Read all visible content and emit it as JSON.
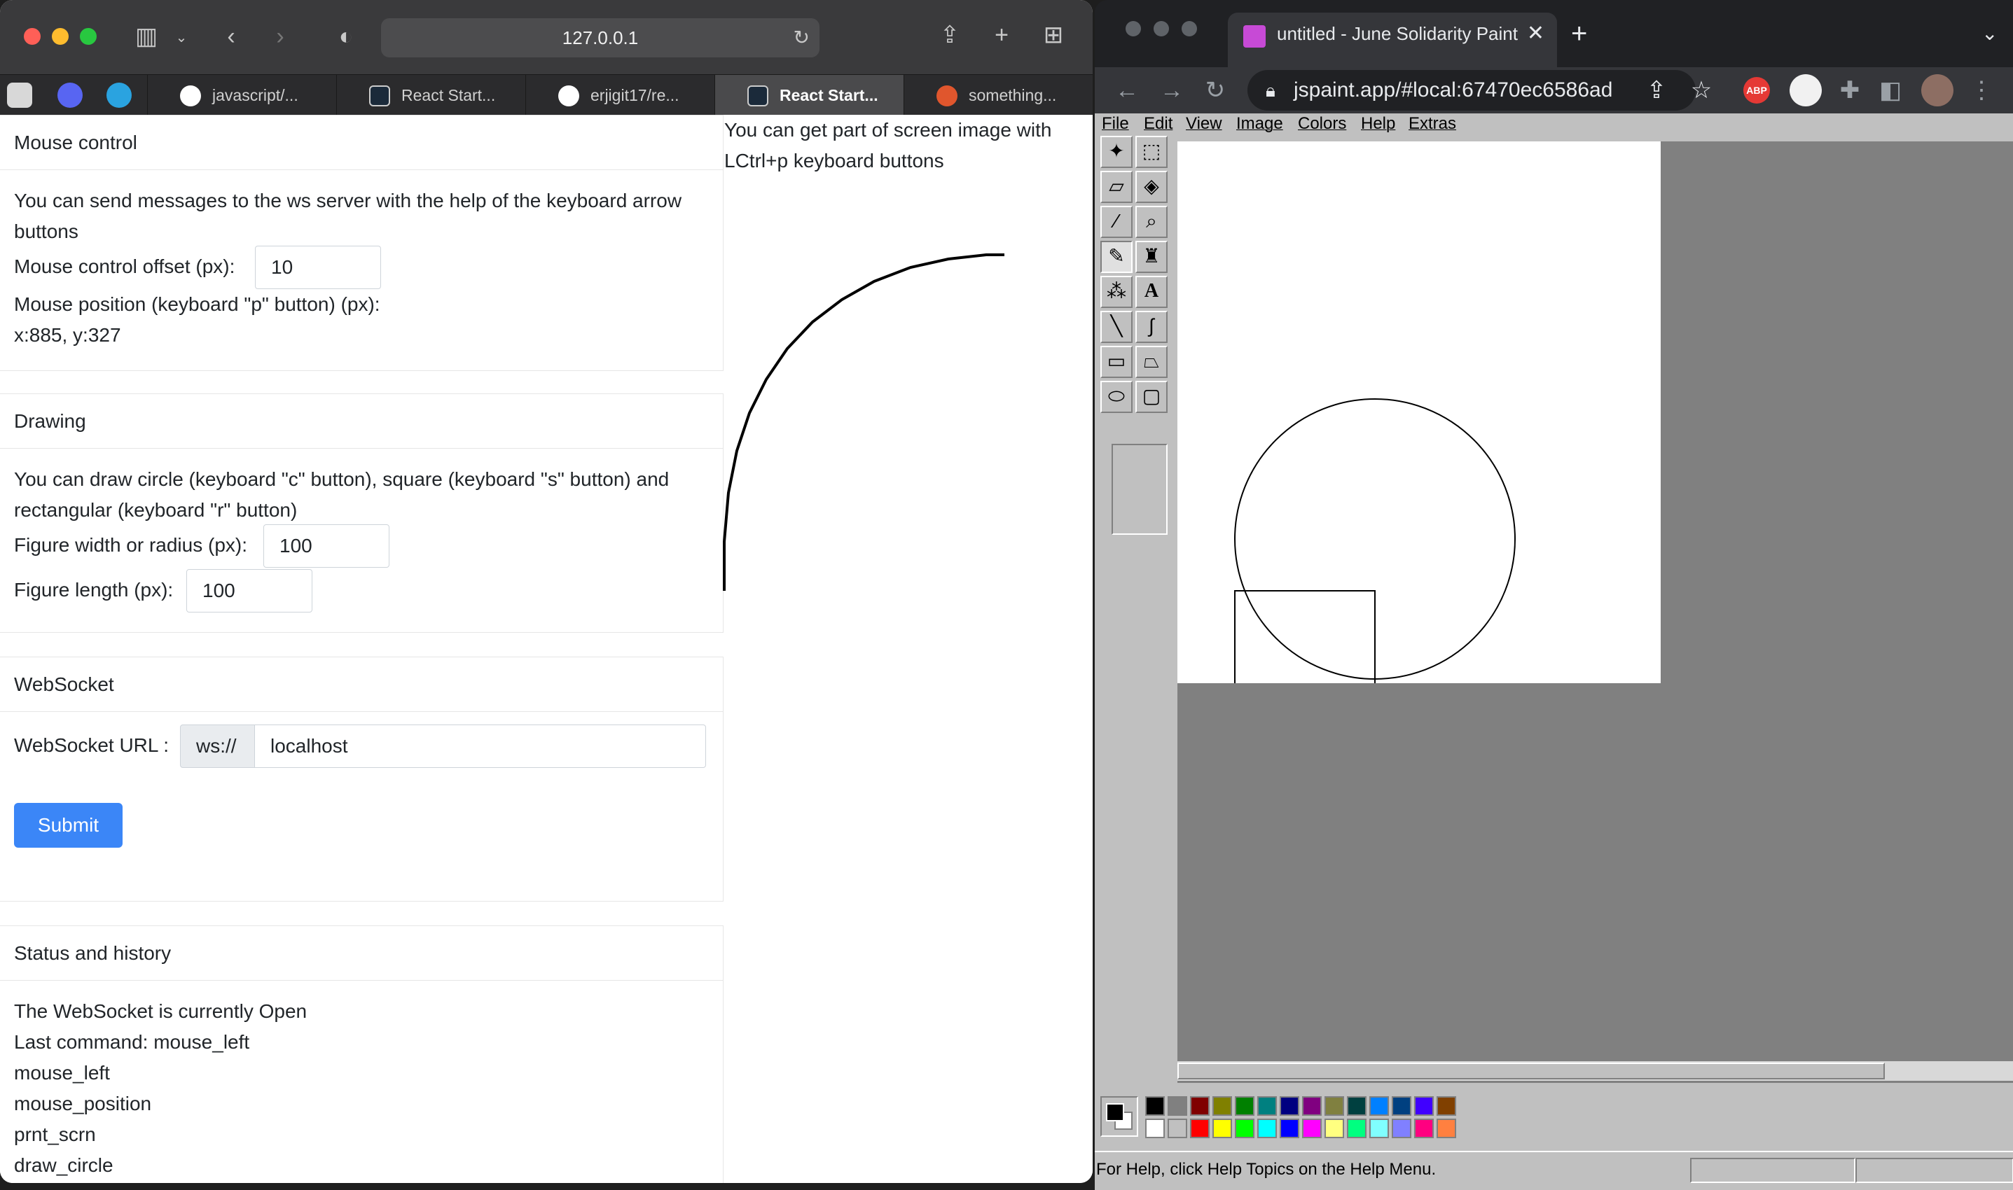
{
  "safari": {
    "url": "127.0.0.1",
    "tabs": [
      {
        "label": "javascript/...",
        "icon": "github-icon",
        "active": false
      },
      {
        "label": "React Start...",
        "icon": "react-starter-icon",
        "active": false
      },
      {
        "label": "erjigit17/re...",
        "icon": "github-icon",
        "active": false
      },
      {
        "label": "React Start...",
        "icon": "react-starter-icon",
        "active": true
      },
      {
        "label": "something...",
        "icon": "rs-school-icon",
        "active": false
      }
    ],
    "pinned_icons": [
      "rs-icon",
      "discord-icon",
      "telegram-icon"
    ]
  },
  "app": {
    "mouse_control": {
      "title": "Mouse control",
      "description": "You can send messages to the ws server with the help of the keyboard arrow buttons",
      "offset_label": "Mouse control offset (px):",
      "offset_value": "10",
      "position_label": "Mouse position (keyboard \"p\" button) (px):",
      "position_value": "x:885, y:327"
    },
    "drawing": {
      "title": "Drawing",
      "description": "You can draw circle (keyboard \"c\" button), square (keyboard \"s\" button) and rectangular (keyboard \"r\" button)",
      "width_label": "Figure width or radius (px):",
      "width_value": "100",
      "length_label": "Figure length (px):",
      "length_value": "100"
    },
    "websocket": {
      "title": "WebSocket",
      "url_label": "WebSocket URL :",
      "prefix": "ws://",
      "url_value": "localhost",
      "submit_label": "Submit"
    },
    "status": {
      "title": "Status and history",
      "lines": [
        "The WebSocket is currently Open",
        "Last command: mouse_left",
        "mouse_left",
        "mouse_position",
        "prnt_scrn",
        "draw_circle"
      ]
    },
    "screenshot_note": "You can get part of screen image with LCtrl+p keyboard buttons"
  },
  "chrome": {
    "tab_title": "untitled - June Solidarity Paint",
    "url": "jspaint.app/#local:67470ec6586ad",
    "new_tab": "+"
  },
  "paint": {
    "menus": [
      "File",
      "Edit",
      "View",
      "Image",
      "Colors",
      "Help",
      "Extras"
    ],
    "tools": [
      {
        "name": "free-form-select-icon",
        "glyph": "✦"
      },
      {
        "name": "select-icon",
        "glyph": "⬚"
      },
      {
        "name": "eraser-icon",
        "glyph": "▱"
      },
      {
        "name": "fill-bucket-icon",
        "glyph": "◈"
      },
      {
        "name": "color-picker-icon",
        "glyph": "⁄"
      },
      {
        "name": "magnifier-icon",
        "glyph": "⌕"
      },
      {
        "name": "pencil-icon",
        "glyph": "✎"
      },
      {
        "name": "brush-icon",
        "glyph": "♜"
      },
      {
        "name": "airbrush-icon",
        "glyph": "⁂"
      },
      {
        "name": "text-icon",
        "glyph": "A"
      },
      {
        "name": "line-icon",
        "glyph": "╲"
      },
      {
        "name": "curve-icon",
        "glyph": "∫"
      },
      {
        "name": "rectangle-icon",
        "glyph": "▭"
      },
      {
        "name": "polygon-icon",
        "glyph": "⏢"
      },
      {
        "name": "ellipse-icon",
        "glyph": "⬭"
      },
      {
        "name": "rounded-rectangle-icon",
        "glyph": "▢"
      }
    ],
    "selected_tool": 6,
    "palette_top": [
      "#000000",
      "#808080",
      "#800000",
      "#808000",
      "#008000",
      "#008080",
      "#000080",
      "#800080",
      "#808040",
      "#004040",
      "#0080ff",
      "#004080",
      "#4000ff",
      "#804000"
    ],
    "palette_bottom": [
      "#ffffff",
      "#c0c0c0",
      "#ff0000",
      "#ffff00",
      "#00ff00",
      "#00ffff",
      "#0000ff",
      "#ff00ff",
      "#ffff80",
      "#00ff80",
      "#80ffff",
      "#8080ff",
      "#ff0080",
      "#ff8040"
    ],
    "status": "For Help, click Help Topics on the Help Menu."
  }
}
